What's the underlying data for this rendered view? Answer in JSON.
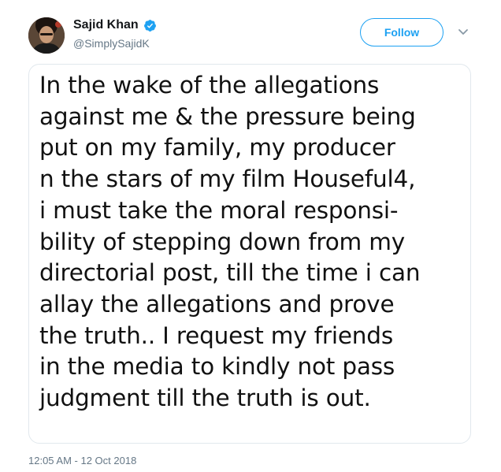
{
  "user": {
    "display_name": "Sajid Khan",
    "handle": "@SimplySajidK",
    "verified": true
  },
  "actions": {
    "follow_label": "Follow",
    "more_icon": "chevron-down-icon"
  },
  "tweet_image": {
    "lines": [
      "In the wake of the allegations",
      "against me & the pressure being",
      "put on my family, my producer",
      "n the stars of my film Houseful4,",
      "i must take the moral responsi-",
      "bility of stepping down from my",
      "directorial post, till the time i can",
      "allay the allegations and prove",
      "the truth.. I request my friends",
      "in the media to kindly not pass",
      "judgment till the truth is out."
    ]
  },
  "meta": {
    "timestamp": "12:05 AM - 12 Oct 2018"
  },
  "colors": {
    "accent": "#1da1f2",
    "secondary_text": "#657786",
    "border": "#e1e8ed"
  }
}
